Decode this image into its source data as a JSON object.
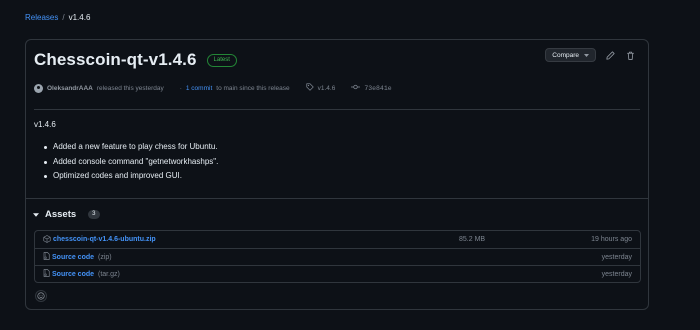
{
  "breadcrumb": {
    "parent": "Releases",
    "separator": "/",
    "current": "v1.4.6"
  },
  "release": {
    "title": "Chesscoin-qt-v1.4.6",
    "latest_badge": "Latest",
    "compare_label": "Compare",
    "author": "OleksandrAAA",
    "released_text": "released this yesterday",
    "commits_dot": "·",
    "commits_link": "1 commit",
    "commits_suffix": "to main since this release",
    "tag": "v1.4.6",
    "commit_hash": "73e841e",
    "body_title": "v1.4.6",
    "notes": [
      "Added a new feature to play chess for Ubuntu.",
      "Added console command \"getnetworkhashps\".",
      "Optimized codes and improved GUI."
    ]
  },
  "assets": {
    "title": "Assets",
    "count": "3",
    "rows": [
      {
        "name": "chesscoin-qt-v1.4.6-ubuntu.zip",
        "suffix": "",
        "size": "85.2 MB",
        "date": "19 hours ago",
        "icon": "package-icon"
      },
      {
        "name": "Source code",
        "suffix": "(zip)",
        "size": "",
        "date": "yesterday",
        "icon": "file-zip-icon"
      },
      {
        "name": "Source code",
        "suffix": "(tar.gz)",
        "size": "",
        "date": "yesterday",
        "icon": "file-zip-icon"
      }
    ]
  },
  "colors": {
    "background": "#0d1117",
    "border": "#30363d",
    "link": "#4493f8",
    "latest": "#3fb950",
    "muted": "#7d8590"
  }
}
